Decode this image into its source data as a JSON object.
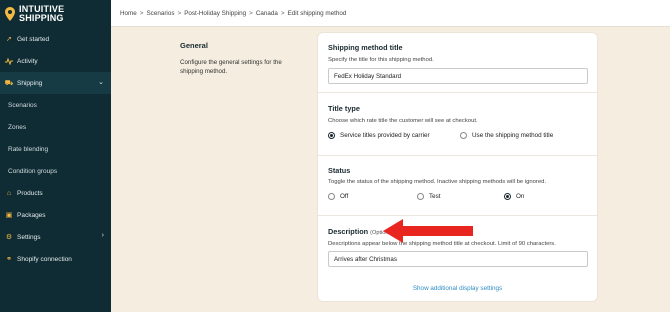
{
  "brand": {
    "line1": "INTUITIVE",
    "line2": "SHIPPING",
    "accent": "#f5b942"
  },
  "sidebar": {
    "items": [
      {
        "label": "Get started",
        "icon": "rocket-icon",
        "glyph": "➚"
      },
      {
        "label": "Activity",
        "icon": "activity-icon",
        "glyph": ""
      },
      {
        "label": "Shipping",
        "icon": "truck-icon",
        "glyph": "⛟"
      },
      {
        "label": "Scenarios"
      },
      {
        "label": "Zones"
      },
      {
        "label": "Rate blending"
      },
      {
        "label": "Condition groups"
      },
      {
        "label": "Products",
        "icon": "tag-icon",
        "glyph": "⌂"
      },
      {
        "label": "Packages",
        "icon": "package-icon",
        "glyph": "▣"
      },
      {
        "label": "Settings",
        "icon": "gear-icon",
        "glyph": "⚙"
      },
      {
        "label": "Shopify connection",
        "icon": "link-icon",
        "glyph": "⚭"
      }
    ]
  },
  "breadcrumb": {
    "items": [
      "Home",
      "Scenarios",
      "Post-Holiday Shipping",
      "Canada",
      "Edit shipping method"
    ],
    "separator": ">"
  },
  "general": {
    "title": "General",
    "description": "Configure the general settings for the shipping method."
  },
  "shipping_method_title": {
    "title": "Shipping method title",
    "description": "Specify the title for this shipping method.",
    "value": "FedEx Holiday Standard"
  },
  "title_type": {
    "title": "Title type",
    "description": "Choose which rate title the customer will see at checkout.",
    "options": [
      "Service titles provided by carrier",
      "Use the shipping method title"
    ],
    "selected": "Service titles provided by carrier"
  },
  "status": {
    "title": "Status",
    "description": "Toggle the status of the shipping method. Inactive shipping methods will be ignored.",
    "options": [
      "Off",
      "Test",
      "On"
    ],
    "selected": "On"
  },
  "description_field": {
    "title": "Description",
    "optional": "(Optional)",
    "description": "Descriptions appear below the shipping method title at checkout. Limit of 90 characters.",
    "value": "Arrives after Christmas"
  },
  "additional_link": "Show additional display settings",
  "annotation": {
    "color": "#e8261f"
  }
}
